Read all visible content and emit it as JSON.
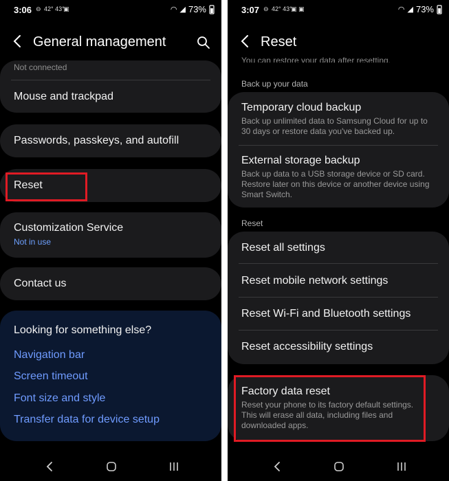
{
  "left": {
    "status": {
      "time": "3:06",
      "battery": "73%",
      "temps": "42° 43°"
    },
    "header": {
      "title": "General management"
    },
    "items": {
      "not_connected": "Not connected",
      "mouse": "Mouse and trackpad",
      "passwords": "Passwords, passkeys, and autofill",
      "reset": "Reset",
      "customization": "Customization Service",
      "customization_sub": "Not in use",
      "contact": "Contact us"
    },
    "looking": {
      "title": "Looking for something else?",
      "links": [
        "Navigation bar",
        "Screen timeout",
        "Font size and style",
        "Transfer data for device setup"
      ]
    }
  },
  "right": {
    "status": {
      "time": "3:07",
      "battery": "73%",
      "temps": "42° 43°"
    },
    "header": {
      "title": "Reset"
    },
    "top_cut": "You can restore your data after resetting.",
    "backup_header": "Back up your data",
    "temp_cloud": {
      "title": "Temporary cloud backup",
      "desc": "Back up unlimited data to Samsung Cloud for up to 30 days or restore data you've backed up."
    },
    "external": {
      "title": "External storage backup",
      "desc": "Back up data to a USB storage device or SD card. Restore later on this device or another device using Smart Switch."
    },
    "reset_header": "Reset",
    "reset_items": [
      "Reset all settings",
      "Reset mobile network settings",
      "Reset Wi-Fi and Bluetooth settings",
      "Reset accessibility settings"
    ],
    "factory": {
      "title": "Factory data reset",
      "desc": "Reset your phone to its factory default settings. This will erase all data, including files and downloaded apps."
    }
  },
  "colors": {
    "highlight": "#e01b24",
    "link": "#6f9bff",
    "card": "#1b1b1d",
    "looking_bg": "#0b1830"
  }
}
